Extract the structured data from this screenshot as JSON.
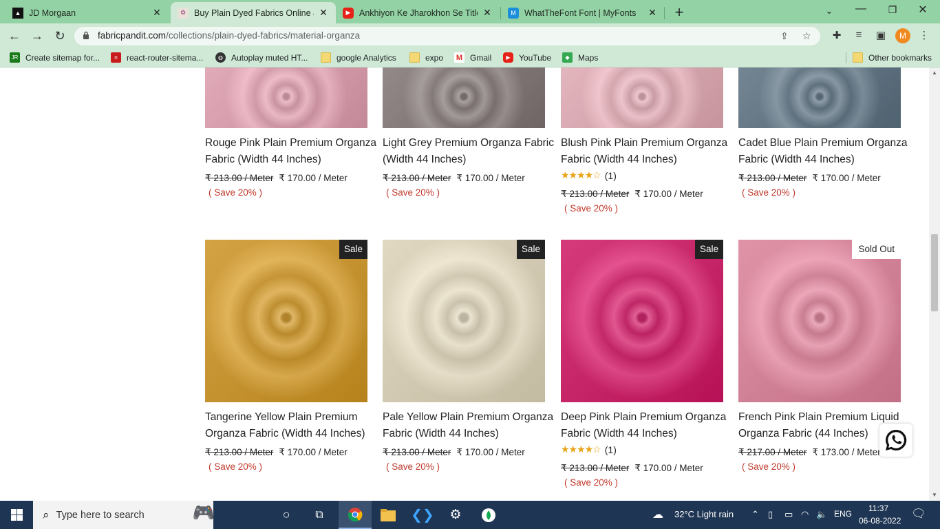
{
  "browser": {
    "tabs": [
      {
        "title": "JD Morgaan",
        "active": false
      },
      {
        "title": "Buy Plain Dyed Fabrics Online at",
        "active": true
      },
      {
        "title": "Ankhiyon Ke Jharokhon Se Title S",
        "active": false
      },
      {
        "title": "WhatTheFont Font | MyFonts",
        "active": false
      }
    ],
    "url_domain": "fabricpandit.com",
    "url_path": "/collections/plain-dyed-fabrics/material-organza",
    "avatar_letter": "M",
    "bookmarks": [
      {
        "label": "Create sitemap for..."
      },
      {
        "label": "react-router-sitema..."
      },
      {
        "label": "Autoplay muted HT..."
      },
      {
        "label": "google Analytics"
      },
      {
        "label": "expo"
      },
      {
        "label": "Gmail"
      },
      {
        "label": "YouTube"
      },
      {
        "label": "Maps"
      },
      {
        "label": "Other bookmarks"
      }
    ]
  },
  "products_top": [
    {
      "name": "Rouge Pink Plain Premium Organza Fabric (Width 44 Inches)",
      "color": "#f2a9bc",
      "rating": "",
      "old_price": "₹ 213.00 / Meter",
      "price": "₹ 170.00 / Meter",
      "save": "( Save 20% )"
    },
    {
      "name": "Light Grey Premium Organza Fabric (Width 44 Inches)",
      "color": "#8a7d7d",
      "rating": "",
      "old_price": "₹ 213.00 / Meter",
      "price": "₹ 170.00 / Meter",
      "save": "( Save 20% )"
    },
    {
      "name": "Blush Pink Plain Premium Organza Fabric (Width 44 Inches)",
      "color": "#f4b7c2",
      "rating": "(1)",
      "old_price": "₹ 213.00 / Meter",
      "price": "₹ 170.00 / Meter",
      "save": "( Save 20% )"
    },
    {
      "name": "Cadet Blue Plain Premium Organza Fabric (Width 44 Inches)",
      "color": "#61788a",
      "rating": "",
      "old_price": "₹ 213.00 / Meter",
      "price": "₹ 170.00 / Meter",
      "save": "( Save 20% )"
    }
  ],
  "products_bottom": [
    {
      "name": "Tangerine Yellow Plain Premium Organza Fabric (Width 44 Inches)",
      "color": "#e0a022",
      "badge": "Sale",
      "rating": "",
      "old_price": "₹ 213.00 / Meter",
      "price": "₹ 170.00 / Meter",
      "save": "( Save 20% )"
    },
    {
      "name": "Pale Yellow Plain Premium Organza Fabric (Width 44 Inches)",
      "color": "#f1e6c8",
      "badge": "Sale",
      "rating": "",
      "old_price": "₹ 213.00 / Meter",
      "price": "₹ 170.00 / Meter",
      "save": "( Save 20% )"
    },
    {
      "name": "Deep Pink Plain Premium Organza Fabric (Width 44 Inches)",
      "color": "#e2156a",
      "badge": "Sale",
      "rating": "(1)",
      "old_price": "₹ 213.00 / Meter",
      "price": "₹ 170.00 / Meter",
      "save": "( Save 20% )"
    },
    {
      "name": "French Pink Plain Premium Liquid Organza Fabric (44 Inches)",
      "color": "#f08aa5",
      "badge": "Sold Out",
      "rating": "",
      "old_price": "₹ 217.00 / Meter",
      "price": "₹ 173.00 / Meter",
      "save": "( Save 20% )"
    }
  ],
  "taskbar": {
    "search_placeholder": "Type here to search",
    "weather": "32°C  Light rain",
    "language": "ENG",
    "time": "11:37",
    "date": "06-08-2022"
  }
}
